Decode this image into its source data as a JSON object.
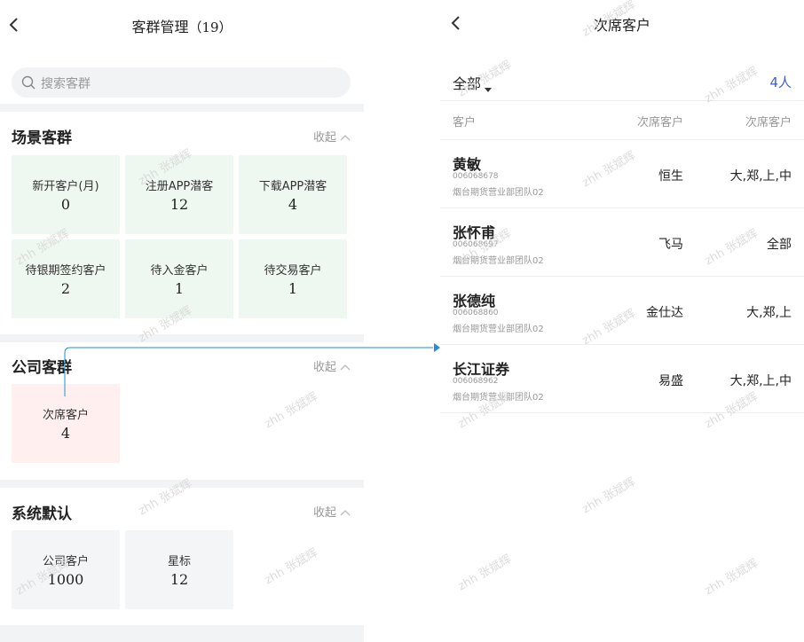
{
  "left": {
    "title": "客群管理",
    "title_count": "（19）",
    "search_placeholder": "搜索客群",
    "sections": [
      {
        "title": "场景客群",
        "collapse_label": "收起",
        "tiles": [
          {
            "label": "新开客户(月)",
            "count": "0"
          },
          {
            "label": "注册APP潜客",
            "count": "12"
          },
          {
            "label": "下载APP潜客",
            "count": "4"
          },
          {
            "label": "待银期签约客户",
            "count": "2"
          },
          {
            "label": "待入金客户",
            "count": "1"
          },
          {
            "label": "待交易客户",
            "count": "1"
          }
        ]
      },
      {
        "title": "公司客群",
        "collapse_label": "收起",
        "tiles": [
          {
            "label": "次席客户",
            "count": "4"
          }
        ]
      },
      {
        "title": "系统默认",
        "collapse_label": "收起",
        "tiles": [
          {
            "label": "公司客户",
            "count": "1000"
          },
          {
            "label": "星标",
            "count": "12"
          }
        ]
      }
    ]
  },
  "right": {
    "title": "次席客户",
    "filter_label": "全部",
    "people_count": "4人",
    "columns": [
      "客户",
      "次席客户",
      "次席客户"
    ],
    "rows": [
      {
        "name": "黄敏",
        "code": "006068678",
        "team": "烟台期货营业部团队02",
        "seat": "恒生",
        "seat2": "大,郑,上,中"
      },
      {
        "name": "张怀甫",
        "code": "006068697",
        "team": "烟台期货营业部团队02",
        "seat": "飞马",
        "seat2": "全部"
      },
      {
        "name": "张德纯",
        "code": "006068860",
        "team": "烟台期货营业部团队02",
        "seat": "金仕达",
        "seat2": "大,郑,上"
      },
      {
        "name": "长江证券",
        "code": "006068962",
        "team": "烟台期货营业部团队02",
        "seat": "易盛",
        "seat2": "大,郑,上,中"
      }
    ]
  },
  "watermark": "zhh 张斌辉",
  "colors": {
    "accent_blue": "#3e5fd6",
    "arrow": "#1a8fe0",
    "tile_green": "#eef7f0",
    "tile_pink": "#fff0ef",
    "tile_gray": "#f4f5f7"
  },
  "icons": [
    "back-icon",
    "search-icon",
    "chevron-up-icon",
    "caret-down-icon"
  ]
}
